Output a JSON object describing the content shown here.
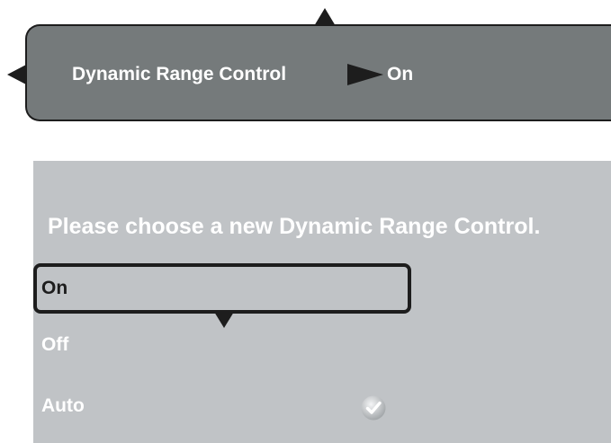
{
  "setting_bar": {
    "name": "Dynamic Range Control",
    "value": "On",
    "icons": {
      "up": "arrow-up-icon",
      "left": "arrow-left-icon",
      "separator": "arrow-right-icon"
    }
  },
  "panel": {
    "prompt": "Please choose a new Dynamic Range Control.",
    "options": [
      {
        "label": "On",
        "highlighted": true
      },
      {
        "label": "Off",
        "highlighted": false
      },
      {
        "label": "Auto",
        "selected": true
      }
    ],
    "icons": {
      "scroll_down": "arrow-down-icon",
      "selected_mark": "check-icon"
    }
  },
  "colors": {
    "bar_background": "#757a7b",
    "panel_background": "#c0c3c6",
    "outline": "#1d1d1d",
    "text": "#ffffff"
  }
}
